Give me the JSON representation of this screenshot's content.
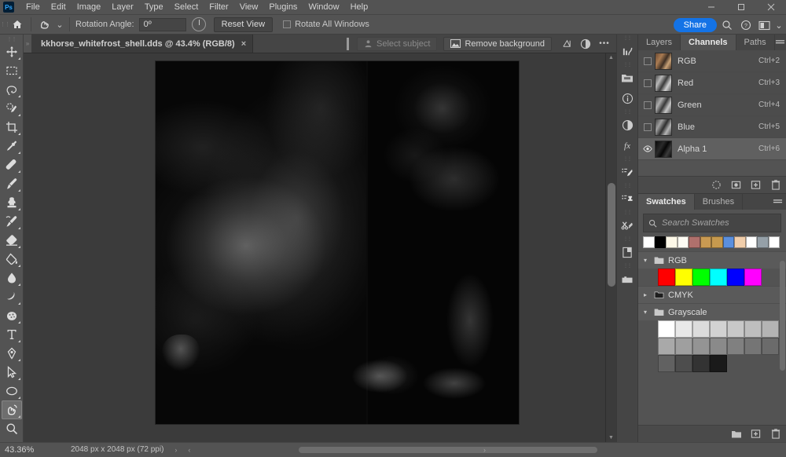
{
  "app": {
    "logo_text": "Ps",
    "menus": [
      "File",
      "Edit",
      "Image",
      "Layer",
      "Type",
      "Select",
      "Filter",
      "View",
      "Plugins",
      "Window",
      "Help"
    ],
    "window_controls": {
      "minimize": "–",
      "maximize": "❐",
      "close": "✕"
    },
    "accent_color": "#1473e6",
    "chrome_color": "#535353"
  },
  "options_bar": {
    "home_icon": "home-icon",
    "tool_icon": "rotate-view-tool-icon",
    "tool_preset_caret": "⌄",
    "rotation_label": "Rotation Angle:",
    "rotation_value": "0º",
    "reset_view_label": "Reset View",
    "rotate_all_label": "Rotate All Windows",
    "rotate_all_checked": false,
    "share_label": "Share",
    "search_icon": "search-icon",
    "help_icon": "help-icon",
    "workspace_icon": "workspace-icon",
    "workspace_caret": "⌄"
  },
  "document_tab": {
    "title": "kkhorse_whitefrost_shell.dds @ 43.4% (RGB/8)",
    "close_glyph": "×",
    "select_subject_label": "Select subject",
    "select_subject_enabled": false,
    "remove_background_label": "Remove background",
    "extra_icons": [
      "transform-icon",
      "contrast-icon",
      "more-options-icon"
    ],
    "more_glyph": "•••"
  },
  "toolbar": {
    "tools": [
      {
        "name": "move-tool",
        "glyph": "move",
        "has_flyout": true,
        "active": false
      },
      {
        "name": "rectangular-marquee-tool",
        "glyph": "marquee",
        "has_flyout": true,
        "active": false
      },
      {
        "name": "lasso-tool",
        "glyph": "lasso",
        "has_flyout": true,
        "active": false
      },
      {
        "name": "object-selection-tool",
        "glyph": "quickselect",
        "has_flyout": true,
        "active": false
      },
      {
        "name": "crop-tool",
        "glyph": "crop",
        "has_flyout": true,
        "active": false
      },
      {
        "name": "eyedropper-tool",
        "glyph": "eyedropper",
        "has_flyout": true,
        "active": false
      },
      {
        "name": "spot-healing-brush-tool",
        "glyph": "healing",
        "has_flyout": true,
        "active": false
      },
      {
        "name": "brush-tool",
        "glyph": "brush",
        "has_flyout": true,
        "active": false
      },
      {
        "name": "clone-stamp-tool",
        "glyph": "stamp",
        "has_flyout": true,
        "active": false
      },
      {
        "name": "history-brush-tool",
        "glyph": "historybrush",
        "has_flyout": true,
        "active": false
      },
      {
        "name": "eraser-tool",
        "glyph": "eraser",
        "has_flyout": true,
        "active": false
      },
      {
        "name": "gradient-tool",
        "glyph": "bucket",
        "has_flyout": true,
        "active": false
      },
      {
        "name": "blur-tool",
        "glyph": "blur",
        "has_flyout": true,
        "active": false
      },
      {
        "name": "dodge-tool",
        "glyph": "dodge",
        "has_flyout": true,
        "active": false
      },
      {
        "name": "sponge-tool",
        "glyph": "sponge",
        "has_flyout": true,
        "active": false
      },
      {
        "name": "type-tool",
        "glyph": "type",
        "has_flyout": true,
        "active": false
      },
      {
        "name": "pen-tool",
        "glyph": "pen",
        "has_flyout": true,
        "active": false
      },
      {
        "name": "path-selection-tool",
        "glyph": "pathselect",
        "has_flyout": true,
        "active": false
      },
      {
        "name": "ellipse-shape-tool",
        "glyph": "shape",
        "has_flyout": true,
        "active": false
      },
      {
        "name": "rotate-view-tool",
        "glyph": "hand",
        "has_flyout": true,
        "active": true
      },
      {
        "name": "zoom-tool",
        "glyph": "zoom",
        "has_flyout": false,
        "active": false
      },
      {
        "name": "edit-toolbar",
        "glyph": "edittoolbar",
        "has_flyout": true,
        "active": false
      }
    ]
  },
  "icon_dock": [
    {
      "name": "histogram-icon"
    },
    {
      "name": "libraries-folder-icon"
    },
    {
      "name": "info-icon"
    },
    {
      "name": "adjustments-icon"
    },
    {
      "name": "layer-styles-fx-icon"
    },
    {
      "name": "brush-settings-icon"
    },
    {
      "name": "clone-source-icon"
    },
    {
      "name": "tool-presets-icon"
    },
    {
      "name": "notes-icon"
    },
    {
      "name": "libraries-icon"
    }
  ],
  "channels_panel": {
    "tabs": [
      {
        "label": "Layers",
        "active": false
      },
      {
        "label": "Channels",
        "active": true
      },
      {
        "label": "Paths",
        "active": false
      }
    ],
    "menu_glyph": "≡",
    "channels": [
      {
        "name": "RGB",
        "shortcut": "Ctrl+2",
        "visible": false,
        "selected": false,
        "thumb_type": "rgb-composite"
      },
      {
        "name": "Red",
        "shortcut": "Ctrl+3",
        "visible": false,
        "selected": false,
        "thumb_type": "grayscale-red"
      },
      {
        "name": "Green",
        "shortcut": "Ctrl+4",
        "visible": false,
        "selected": false,
        "thumb_type": "grayscale-green"
      },
      {
        "name": "Blue",
        "shortcut": "Ctrl+5",
        "visible": false,
        "selected": false,
        "thumb_type": "grayscale-blue"
      },
      {
        "name": "Alpha 1",
        "shortcut": "Ctrl+6",
        "visible": true,
        "selected": true,
        "thumb_type": "alpha-dark"
      }
    ],
    "footer_icons": [
      "load-channel-as-selection-icon",
      "save-selection-as-channel-icon",
      "create-new-channel-icon",
      "delete-channel-icon"
    ]
  },
  "swatches_panel": {
    "tabs": [
      {
        "label": "Swatches",
        "active": true
      },
      {
        "label": "Brushes",
        "active": false
      }
    ],
    "menu_glyph": "≡",
    "search_placeholder": "Search Swatches",
    "search_value": "",
    "search_icon": "search-icon",
    "recent_swatches": [
      "#ffffff",
      "#000000",
      "#fdf8e8",
      "#fdfbf3",
      "#b0706c",
      "#c99a52",
      "#c79a4e",
      "#5b8fdd",
      "#f0cdaa",
      "#ffffff",
      "#95a0a8",
      "#ffffff"
    ],
    "groups": [
      {
        "label": "RGB",
        "expanded": true,
        "colors": [
          "#ff0000",
          "#ffff00",
          "#00ff00",
          "#00ffff",
          "#0000ff",
          "#ff00ff"
        ]
      },
      {
        "label": "CMYK",
        "expanded": false,
        "colors": []
      },
      {
        "label": "Grayscale",
        "expanded": true,
        "colors": [
          "#ffffff",
          "#e8e8e8",
          "#dcdcdc",
          "#d2d2d2",
          "#c8c8c8",
          "#bebebe",
          "#b4b4b4",
          "#a9a9a9",
          "#9f9f9f",
          "#949494",
          "#8a8a8a",
          "#808080",
          "#757575",
          "#6b6b6b",
          "#616161",
          "#4d4d4d",
          "#333333",
          "#1a1a1a"
        ]
      }
    ],
    "footer_icons": [
      "new-group-folder-icon",
      "new-swatch-icon",
      "delete-swatch-icon"
    ]
  },
  "status_bar": {
    "zoom_level": "43.36%",
    "document_info": "2048 px x 2048 px (72 ppi)",
    "right_caret": "›",
    "left_caret": "‹"
  }
}
